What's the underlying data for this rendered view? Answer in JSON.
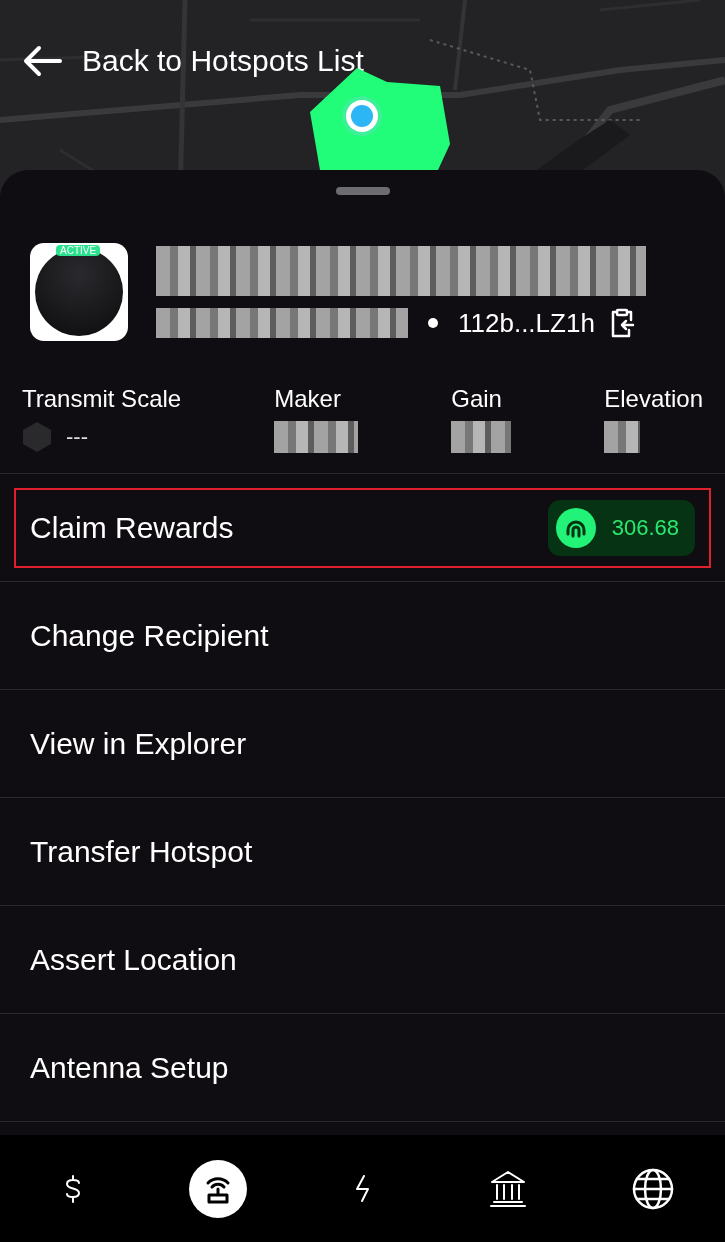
{
  "header": {
    "back_label": "Back to Hotspots List"
  },
  "hotspot": {
    "status_badge": "ACTIVE",
    "address": "112b...LZ1h"
  },
  "stats": [
    {
      "label": "Transmit Scale",
      "value": "---",
      "kind": "scale"
    },
    {
      "label": "Maker",
      "kind": "redacted"
    },
    {
      "label": "Gain",
      "kind": "redacted"
    },
    {
      "label": "Elevation",
      "kind": "redacted"
    }
  ],
  "actions": [
    {
      "label": "Claim Rewards",
      "highlighted": true,
      "reward": "306.68"
    },
    {
      "label": "Change Recipient",
      "highlighted": false
    },
    {
      "label": "View in Explorer",
      "highlighted": false
    },
    {
      "label": "Transfer Hotspot",
      "highlighted": false
    },
    {
      "label": "Assert Location",
      "highlighted": false
    },
    {
      "label": "Antenna Setup",
      "highlighted": false
    }
  ],
  "nav": [
    {
      "kind": "dollar",
      "selected": false
    },
    {
      "kind": "hotspot",
      "selected": true
    },
    {
      "kind": "bolt",
      "selected": false
    },
    {
      "kind": "bank",
      "selected": false
    },
    {
      "kind": "globe",
      "selected": false
    }
  ]
}
